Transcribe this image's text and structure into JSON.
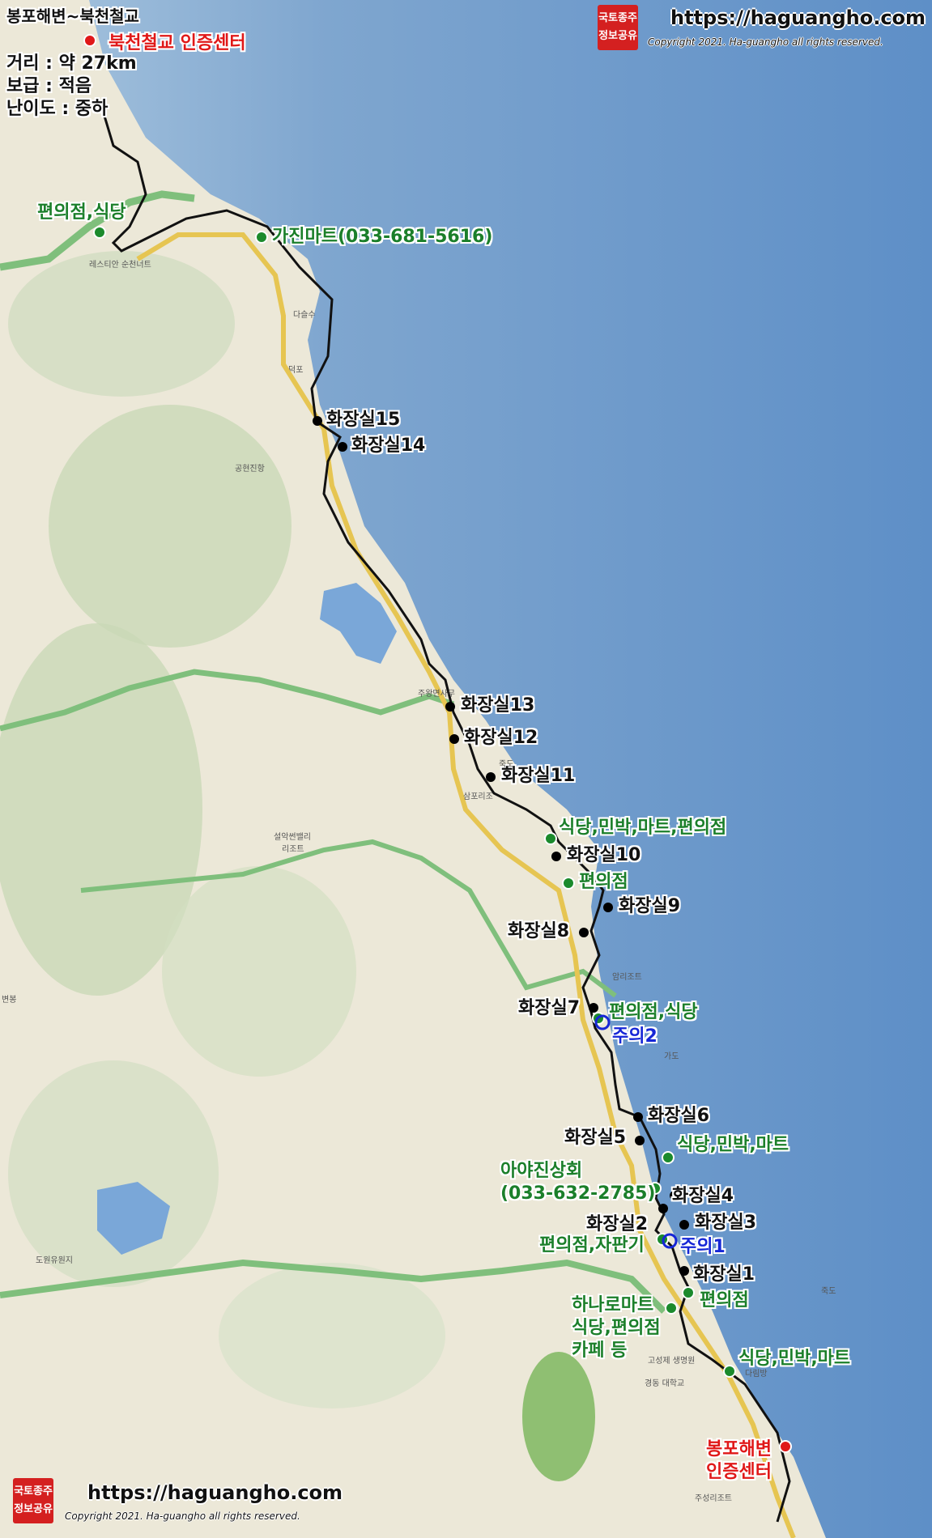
{
  "header": {
    "route_title": "봉포해변~북천철교",
    "end_label": "북천철교 인증센터",
    "distance": "거리 : 약 27km",
    "supply": "보급 : 적음",
    "difficulty": "난이도 : 중하"
  },
  "branding": {
    "seal_line1": "국토종주",
    "seal_line2": "정보공유",
    "site_url": "https://haguangho.com",
    "copyright": "Copyright 2021. Ha-guangho all rights reserved."
  },
  "toilets": {
    "t15": "화장실15",
    "t14": "화장실14",
    "t13": "화장실13",
    "t12": "화장실12",
    "t11": "화장실11",
    "t10": "화장실10",
    "t9": "화장실9",
    "t8": "화장실8",
    "t7": "화장실7",
    "t6": "화장실6",
    "t5": "화장실5",
    "t4": "화장실4",
    "t3": "화장실3",
    "t2": "화장실2",
    "t1": "화장실1"
  },
  "stores": {
    "s_top_left": "편의점,식당",
    "s_gajin": "가진마트(033-681-5616)",
    "s_a": "식당,민박,마트,편의점",
    "s_b": "편의점",
    "s_c": "편의점,식당",
    "s_d": "식당,민박,마트",
    "s_e1": "아야진상회",
    "s_e2": "(033-632-2785)",
    "s_f": "편의점,자판기",
    "s_g": "편의점",
    "s_h1": "하나로마트",
    "s_h2": "식당,편의점",
    "s_h3": "카페 등",
    "s_i": "식당,민박,마트"
  },
  "cautions": {
    "c1": "주의1",
    "c2": "주의2"
  },
  "start": {
    "line1": "봉포해변",
    "line2": "인증센터"
  },
  "place_names": {
    "p1": "다슬수",
    "p2": "덕포",
    "p3": "공현진항",
    "p4": "주왕면사무",
    "p5": "죽도",
    "p6": "삼포리조",
    "p7": "설악썬밸리",
    "p8": "리조트",
    "p9": "암리조트",
    "p10": "가도",
    "p11": "고성제 생명원",
    "p12": "경동 대학교",
    "p13": "주성리조트",
    "p14": "도원유원지",
    "p15": "변봉",
    "p16": "레스티안 순천너트",
    "p17": "죽도",
    "p18": "다림방"
  },
  "colors": {
    "sea": "#6f9bcb",
    "land": "#eeeadc",
    "route": "#111111",
    "road": "#e8c95a",
    "river": "#7fbf7c",
    "toilet_dot": "#000000",
    "store_dot": "#1b8a2c",
    "caution": "#1626d6",
    "center": "#e01818"
  }
}
